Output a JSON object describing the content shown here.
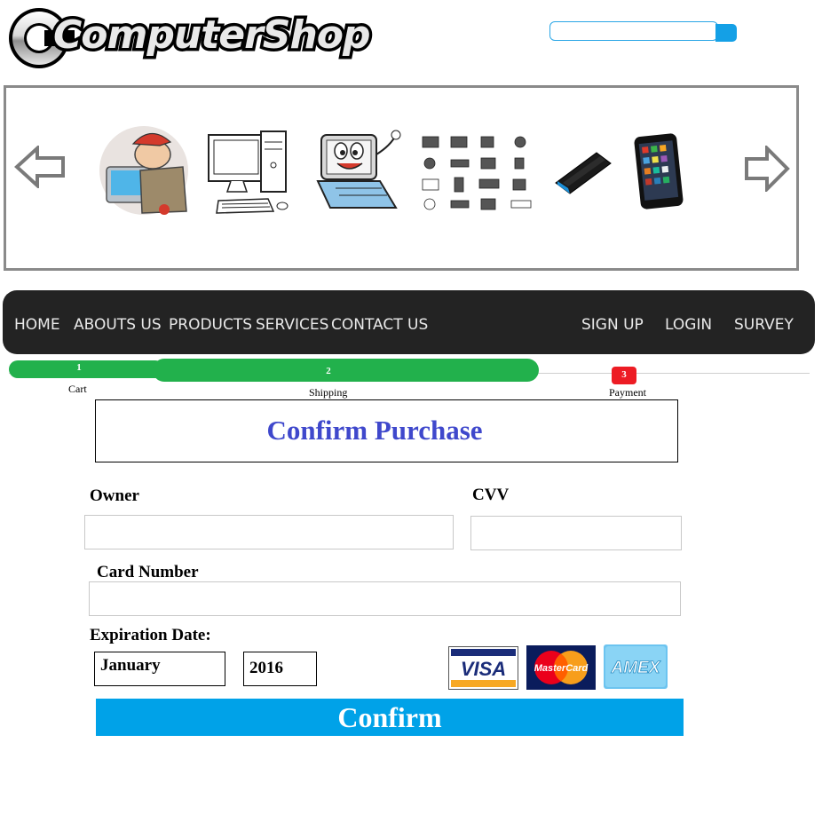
{
  "logo": {
    "text": "ComputerShop"
  },
  "search": {
    "placeholder": ""
  },
  "carousel": {
    "items": [
      "technician",
      "desktop-computer",
      "laptop",
      "components-grid",
      "smartphone",
      "tablet"
    ]
  },
  "nav": {
    "left": [
      "HOME",
      "ABOUTS US",
      "PRODUCTS",
      "SERVICES",
      "CONTACT US"
    ],
    "right": [
      "SIGN UP",
      "LOGIN",
      "SURVEY"
    ]
  },
  "steps": [
    {
      "number": "1",
      "label": "Cart",
      "state": "complete",
      "color": "#22b14c"
    },
    {
      "number": "2",
      "label": "Shipping",
      "state": "complete",
      "color": "#22b14c"
    },
    {
      "number": "3",
      "label": "Payment",
      "state": "current",
      "color": "#ed1c24"
    }
  ],
  "form": {
    "title": "Confirm Purchase",
    "owner_label": "Owner",
    "owner_value": "",
    "cvv_label": "CVV",
    "cvv_value": "",
    "card_number_label": "Card Number",
    "card_number_value": "",
    "expiration_label": "Expiration Date:",
    "month": "January",
    "year": "2016",
    "cards": [
      "VISA",
      "MasterCard",
      "AMEX"
    ],
    "confirm_label": "Confirm"
  },
  "colors": {
    "nav_bg": "#232323",
    "accent_blue": "#00a2e8",
    "title_blue": "#3f48cc",
    "step_green": "#22b14c",
    "step_red": "#ed1c24"
  }
}
